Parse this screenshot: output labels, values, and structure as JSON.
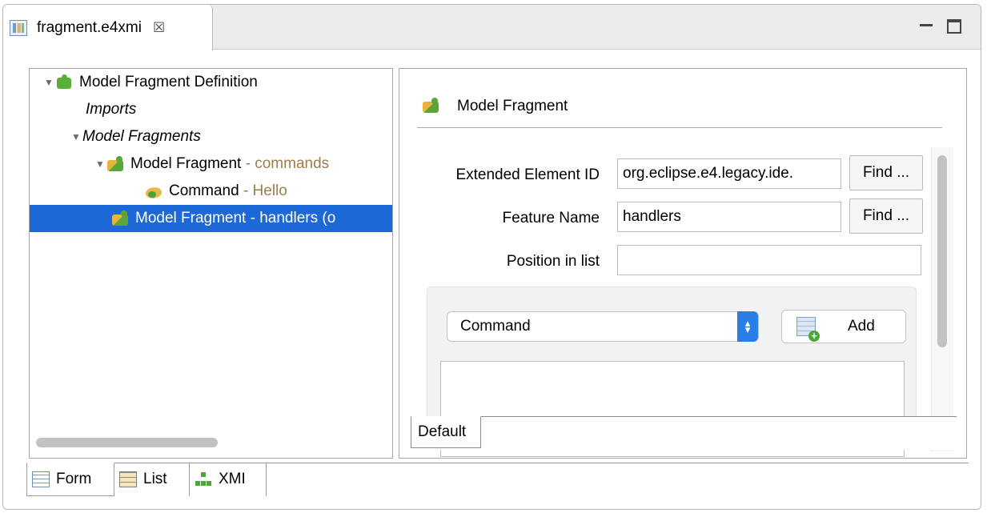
{
  "editor": {
    "tab_title": "fragment.e4xmi",
    "close_glyph": "☒",
    "file_icon": "e4xmi-file-icon",
    "window_controls": [
      "minimize",
      "maximize"
    ]
  },
  "tree": {
    "items": [
      {
        "label": "Model Fragment Definition",
        "suffix": "",
        "icon": "puzzle-green-icon",
        "expanded": true,
        "italic": false
      },
      {
        "label": "Imports",
        "suffix": "",
        "icon": "",
        "expanded": null,
        "italic": true
      },
      {
        "label": "Model Fragments",
        "suffix": "",
        "icon": "",
        "expanded": true,
        "italic": true
      },
      {
        "label": "Model Fragment",
        "suffix": " - commands",
        "icon": "puzzle-mixed-icon",
        "expanded": true,
        "italic": false
      },
      {
        "label": "Command",
        "suffix": " - Hello",
        "icon": "command-icon",
        "expanded": null,
        "italic": false
      },
      {
        "label": "Model Fragment - handlers (o",
        "suffix": "",
        "icon": "puzzle-mixed-icon",
        "expanded": null,
        "italic": false,
        "selected": true
      }
    ]
  },
  "detail": {
    "header_title": "Model Fragment",
    "fields": {
      "extended_element_id": {
        "label": "Extended Element ID",
        "value": "org.eclipse.e4.legacy.ide."
      },
      "feature_name": {
        "label": "Feature Name",
        "value": "handlers"
      },
      "position_in_list": {
        "label": "Position in list",
        "value": ""
      }
    },
    "find_label": "Find ...",
    "combo_value": "Command",
    "add_label": "Add",
    "tab_default": "Default"
  },
  "bottom_tabs": [
    {
      "label": "Form",
      "icon": "form-icon",
      "active": true
    },
    {
      "label": "List",
      "icon": "table-icon",
      "active": false
    },
    {
      "label": "XMI",
      "icon": "xmi-tree-icon",
      "active": false
    }
  ],
  "colors": {
    "selection": "#1c68d7",
    "suffix_text": "#9c7e4e",
    "combo_arrow": "#2a7fe6"
  }
}
